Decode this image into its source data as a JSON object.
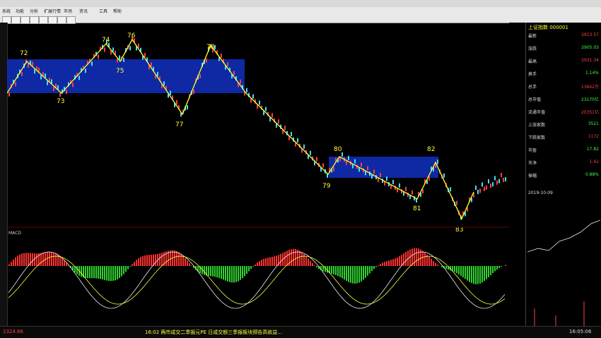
{
  "chart_data": {
    "type": "line",
    "annotations": [
      "72",
      "73",
      "74",
      "75",
      "76",
      "77",
      "78",
      "79",
      "80",
      "81",
      "82",
      "83"
    ],
    "indicator": "MACD"
  },
  "right_panel": {
    "title": "上证指数 000001",
    "rows": [
      {
        "l": "最新",
        "v": "2913.57"
      },
      {
        "l": "涨跌",
        "v": "2905.03"
      },
      {
        "l": "最高",
        "v": "2931.34"
      },
      {
        "l": "换手",
        "v": "1.14%"
      },
      {
        "l": "总手",
        "v": "13842万"
      },
      {
        "l": "总市值",
        "v": "23170亿"
      },
      {
        "l": "流通市值",
        "v": "20351亿"
      },
      {
        "l": "上涨家数",
        "v": "3521"
      },
      {
        "l": "下跌家数",
        "v": "1172"
      },
      {
        "l": "市盈",
        "v": "17.82"
      },
      {
        "l": "市净",
        "v": "1.42"
      },
      {
        "l": "振幅",
        "v": "0.88%"
      }
    ],
    "time": "2019-10-09"
  },
  "status": {
    "left": "2324.66",
    "ticker": "16:02 两市成交二季报元PE 日成交额三季报板块预告高收益...",
    "time": "16:05:06"
  }
}
